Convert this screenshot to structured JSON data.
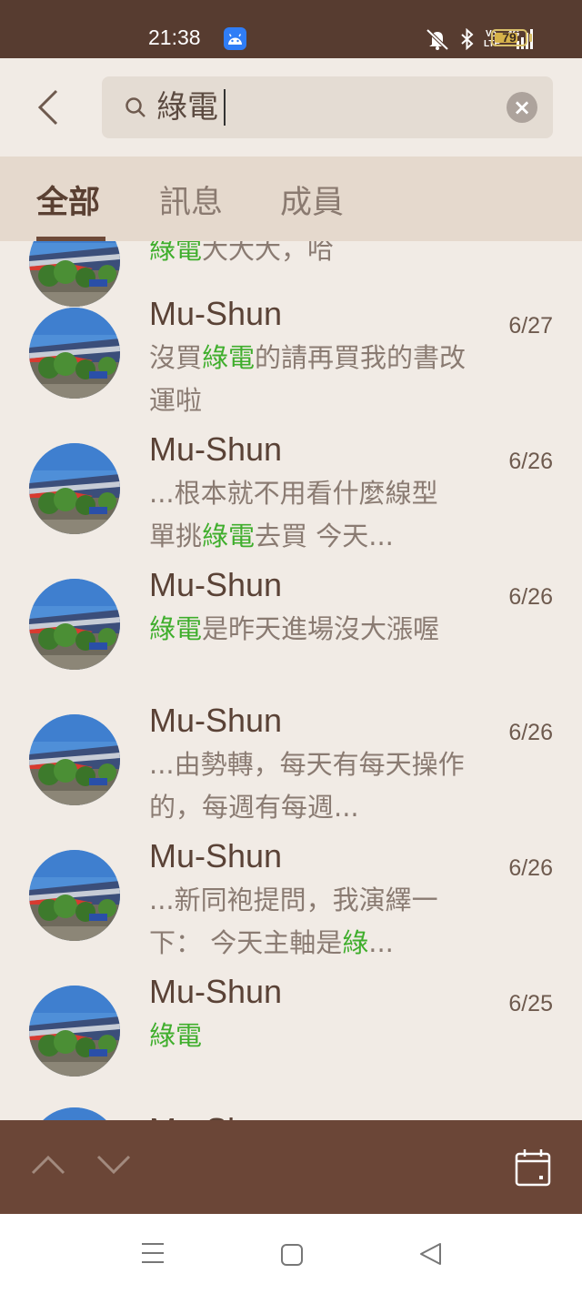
{
  "status_bar": {
    "time": "21:38",
    "battery_level": "79",
    "network_label": "4G",
    "volte_label": "Vo LTE",
    "icons": [
      "app-badge-icon",
      "mute-icon",
      "bluetooth-icon",
      "volte-icon",
      "signal-icon",
      "battery-icon"
    ]
  },
  "search": {
    "query": "綠電",
    "back_icon": "back-chevron-icon",
    "clear_icon": "clear-icon"
  },
  "tabs": [
    {
      "label": "全部",
      "active": true
    },
    {
      "label": "訊息",
      "active": false
    },
    {
      "label": "成員",
      "active": false
    }
  ],
  "partial_top_snippet": [
    "綠電",
    "大大大，哈"
  ],
  "results": [
    {
      "name": "Mu-Shun",
      "date": "6/27",
      "pre": "沒買",
      "hit": "綠電",
      "post": "的請再買我的書改運啦"
    },
    {
      "name": "Mu-Shun",
      "date": "6/26",
      "pre": "...根本就不用看什麼線型 單挑",
      "hit": "綠電",
      "post": "去買 今天..."
    },
    {
      "name": "Mu-Shun",
      "date": "6/26",
      "pre": "",
      "hit": "綠電",
      "post": "是昨天進場沒大漲喔"
    },
    {
      "name": "Mu-Shun",
      "date": "6/26",
      "pre": "...由勢轉，每天有每天操作的，每週有每週...",
      "hit": "",
      "post": ""
    },
    {
      "name": "Mu-Shun",
      "date": "6/26",
      "pre": "...新同袍提問，我演繹一下： 今天主軸是",
      "hit": "綠",
      "post": "..."
    },
    {
      "name": "Mu-Shun",
      "date": "6/25",
      "pre": "",
      "hit": "綠電",
      "post": ""
    }
  ],
  "partial_bottom_name": "Mu-Shun",
  "toolbar": {
    "up_icon": "chevron-up-icon",
    "down_icon": "chevron-down-icon",
    "calendar_icon": "calendar-icon"
  },
  "colors": {
    "status_bar": "#573c30",
    "toolbar": "#6b4637",
    "highlight": "#3fae2c",
    "background": "#f1ebe5",
    "tabs_bg": "#e5d9cd"
  }
}
